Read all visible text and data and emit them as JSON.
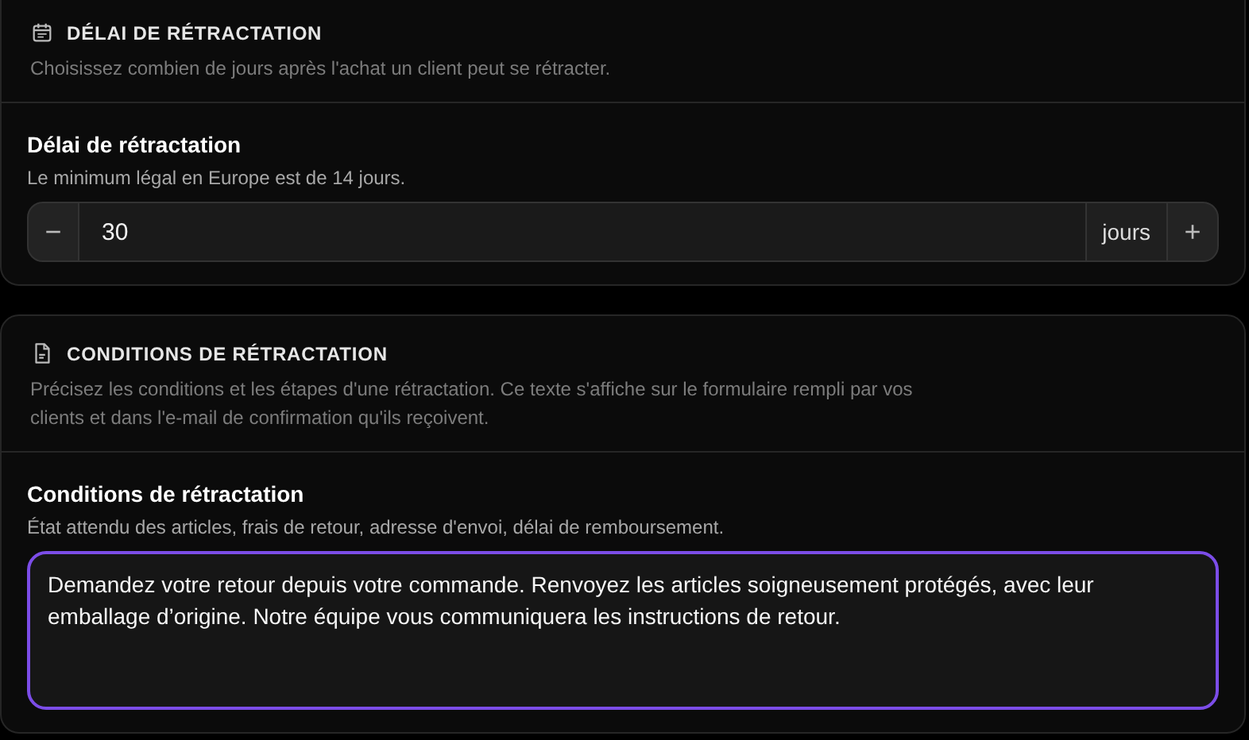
{
  "sections": [
    {
      "title": "DÉLAI DE RÉTRACTATION",
      "description": "Choisissez combien de jours après l'achat un client peut se rétracter.",
      "field": {
        "kind": "stepper",
        "label": "Délai de rétractation",
        "hint": "Le minimum légal en Europe est de 14 jours.",
        "decrement": "−",
        "value": "30",
        "unit": "jours",
        "increment": "+",
        "focused": false
      }
    },
    {
      "title": "CONDITIONS DE RÉTRACTATION",
      "description": "Précisez les conditions et les étapes d'une rétractation. Ce texte s'affiche sur le formulaire rempli par vos clients et dans l'e-mail de confirmation qu'ils reçoivent.",
      "field": {
        "kind": "textarea",
        "label": "Conditions de rétractation",
        "hint": "État attendu des articles, frais de retour, adresse d'envoi, délai de remboursement.",
        "value": "Demandez votre retour depuis votre commande. Renvoyez les articles soigneusement protégés, avec leur emballage d’origine. Notre équipe vous communiquera les instructions de retour.",
        "focused": true
      }
    }
  ]
}
